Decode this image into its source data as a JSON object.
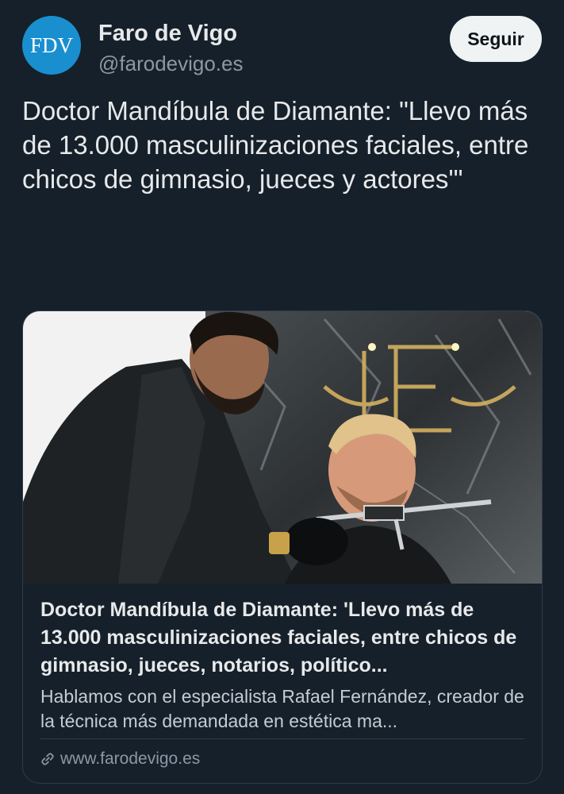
{
  "account": {
    "avatar_text": "FDV",
    "display_name": "Faro de Vigo",
    "handle": "@farodevigo.es",
    "follow_label": "Seguir"
  },
  "tweet": {
    "text": "Doctor Mandíbula de Diamante: \"Llevo más de 13.000 masculinizaciones faciales, entre chicos de gimnasio, jueces y actores'\""
  },
  "card": {
    "title": "Doctor Mandíbula de Diamante: 'Llevo más de 13.000 masculinizaciones faciales, entre chicos de gimnasio, jueces, notarios, político...",
    "description": "Hablamos con el especialista Rafael Fernández, creador de la técnica más demandada en estética ma...",
    "domain": "www.farodevigo.es",
    "image_icon": "photo-doctor-measuring-jaw"
  },
  "colors": {
    "background": "#16202a",
    "avatar": "#1a8fd0",
    "follow_button": "#eff3f4",
    "muted_text": "#8b98a5"
  }
}
